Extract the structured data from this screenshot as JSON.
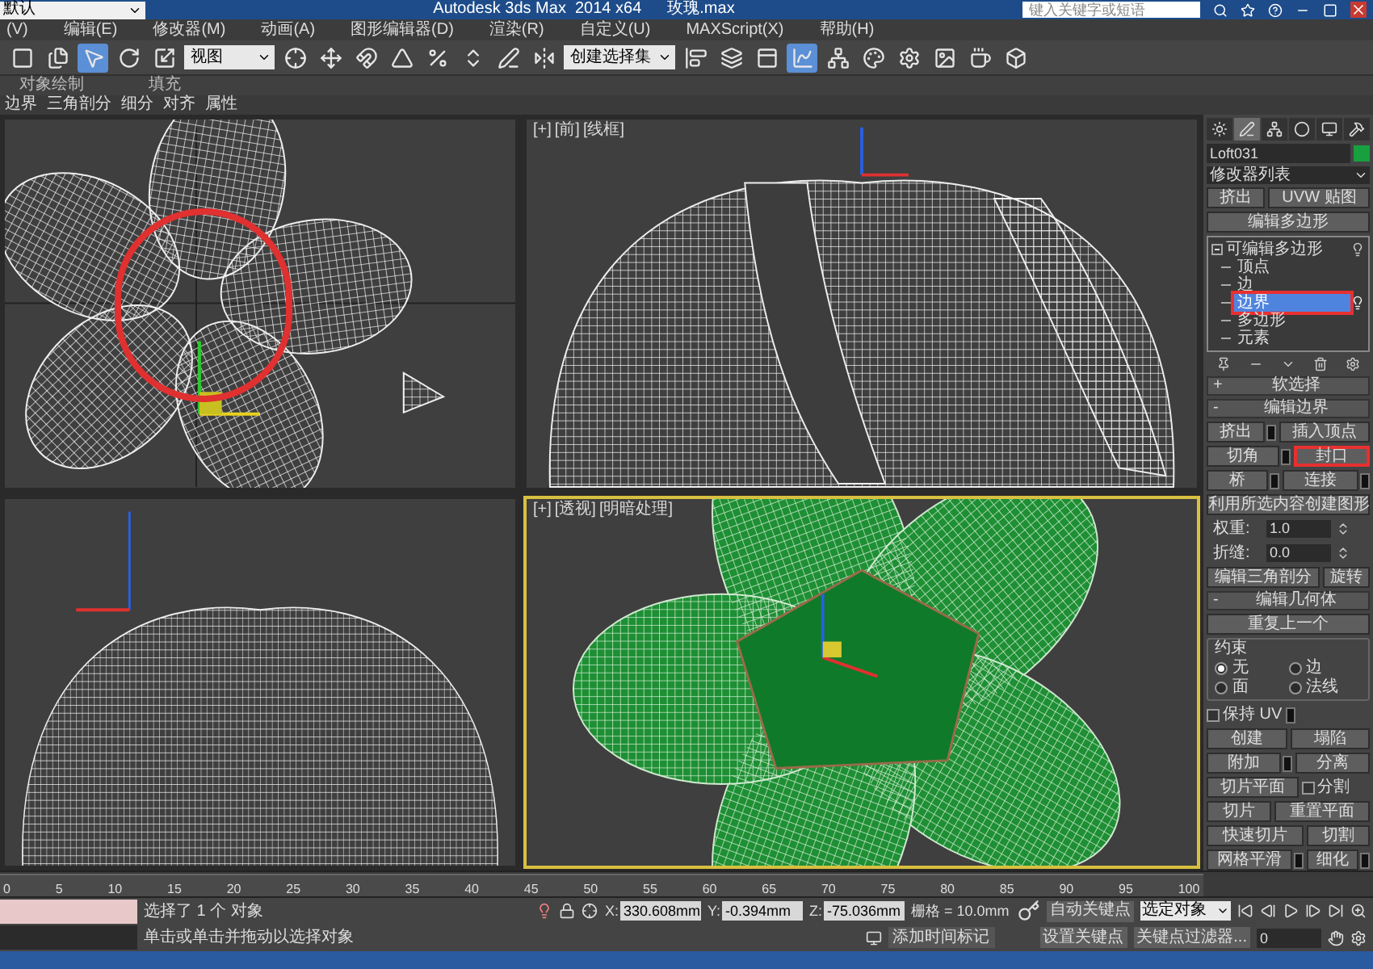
{
  "title_bar": {
    "workspace": "默认",
    "title": "Autodesk 3ds Max  2014 x64",
    "file": "玫瑰.max",
    "search_placeholder": "键入关键字或短语"
  },
  "menu": [
    "(V)",
    "编辑(E)",
    "修改器(M)",
    "动画(A)",
    "图形编辑器(D)",
    "渲染(R)",
    "自定义(U)",
    "MAXScript(X)",
    "帮助(H)"
  ],
  "toolbar": [
    {
      "kind": "tool",
      "selected": false
    },
    {
      "kind": "tool",
      "selected": false
    },
    {
      "kind": "tool",
      "selected": true
    },
    {
      "kind": "tool",
      "selected": false
    },
    {
      "kind": "tool",
      "selected": false
    },
    {
      "kind": "dropdown",
      "label": "视图"
    },
    {
      "kind": "tool",
      "selected": false
    },
    {
      "kind": "tool",
      "selected": false
    },
    {
      "kind": "tool",
      "selected": false
    },
    {
      "kind": "tool",
      "selected": false
    },
    {
      "kind": "tool",
      "selected": false
    },
    {
      "kind": "tool",
      "selected": false
    },
    {
      "kind": "tool",
      "selected": false
    },
    {
      "kind": "tool",
      "selected": false
    },
    {
      "kind": "dropdown",
      "label": "创建选择集"
    },
    {
      "kind": "tool",
      "selected": false
    },
    {
      "kind": "tool",
      "selected": false
    },
    {
      "kind": "tool",
      "selected": false
    },
    {
      "kind": "tool",
      "selected": true
    },
    {
      "kind": "tool",
      "selected": false
    },
    {
      "kind": "tool",
      "selected": false
    },
    {
      "kind": "tool",
      "selected": false
    },
    {
      "kind": "tool",
      "selected": false
    },
    {
      "kind": "tool",
      "selected": false
    },
    {
      "kind": "tool",
      "selected": false
    }
  ],
  "ribbon": {
    "groups": [
      "对象绘制",
      "填充"
    ],
    "tabs": [
      "边界",
      "三角剖分",
      "细分",
      "对齐",
      "属性"
    ]
  },
  "viewports": [
    {
      "kind": "top",
      "active": false,
      "annotated": true
    },
    {
      "kind": "front",
      "active": false,
      "labels": [
        "[+]",
        "[前]",
        "[线框]"
      ]
    },
    {
      "kind": "left",
      "active": false
    },
    {
      "kind": "perspective",
      "active": true,
      "labels": [
        "[+]",
        "[透视]",
        "[明暗处理]"
      ]
    }
  ],
  "command_panel": {
    "tabs": [
      {
        "selected": false
      },
      {
        "selected": true
      },
      {
        "selected": false
      },
      {
        "selected": false
      },
      {
        "selected": false
      },
      {
        "selected": false
      }
    ],
    "object_name": "Loft031",
    "modifier_list": "修改器列表",
    "quick_buttons": [
      "挤出",
      "UVW 贴图",
      "编辑多边形"
    ],
    "stack": [
      {
        "label": "可编辑多边形",
        "expanded": true,
        "children": [
          {
            "label": "顶点",
            "selected": false,
            "annotated": false
          },
          {
            "label": "边",
            "selected": false,
            "annotated": false
          },
          {
            "label": "边界",
            "selected": true,
            "annotated": true
          },
          {
            "label": "多边形",
            "selected": false,
            "annotated": false
          },
          {
            "label": "元素",
            "selected": false,
            "annotated": false
          }
        ]
      }
    ],
    "rollouts": [
      {
        "toggle": "+",
        "title": "软选择"
      },
      {
        "toggle": "-",
        "title": "编辑边界",
        "rows": [
          {
            "kind": "pair",
            "items": [
              {
                "kind": "button",
                "label": "挤出",
                "settings": true,
                "annotated": false
              },
              {
                "kind": "button",
                "label": "插入顶点",
                "settings": false,
                "annotated": false
              }
            ]
          },
          {
            "kind": "pair",
            "items": [
              {
                "kind": "button",
                "label": "切角",
                "settings": true,
                "annotated": false
              },
              {
                "kind": "button",
                "label": "封口",
                "settings": false,
                "annotated": true
              }
            ]
          },
          {
            "kind": "pair",
            "items": [
              {
                "kind": "button",
                "label": "桥",
                "settings": true,
                "annotated": false
              },
              {
                "kind": "button",
                "label": "连接",
                "settings": true,
                "annotated": false
              }
            ]
          },
          {
            "kind": "wide",
            "label": "利用所选内容创建图形"
          },
          {
            "kind": "spinner",
            "label": "权重:",
            "value": "1.0"
          },
          {
            "kind": "spinner",
            "label": "折缝:",
            "value": "0.0"
          },
          {
            "kind": "pair",
            "items": [
              {
                "kind": "button",
                "label": "编辑三角剖分",
                "settings": false,
                "annotated": false
              },
              {
                "kind": "button",
                "label": "旋转",
                "settings": false,
                "annotated": false
              }
            ]
          }
        ]
      },
      {
        "toggle": "-",
        "title": "编辑几何体",
        "rows": [
          {
            "kind": "wide",
            "label": "重复上一个"
          },
          {
            "kind": "radio",
            "title": "约束",
            "options": [
              {
                "label": "无",
                "selected": true
              },
              {
                "label": "边",
                "selected": false
              },
              {
                "label": "面",
                "selected": false
              },
              {
                "label": "法线",
                "selected": false
              }
            ]
          },
          {
            "kind": "pair",
            "items": [
              {
                "kind": "checkbox",
                "label": "保持 UV",
                "checked": false,
                "settings": true
              }
            ]
          },
          {
            "kind": "pair",
            "items": [
              {
                "kind": "button",
                "label": "创建",
                "settings": false,
                "annotated": false
              },
              {
                "kind": "button",
                "label": "塌陷",
                "settings": false,
                "annotated": false
              }
            ]
          },
          {
            "kind": "pair",
            "items": [
              {
                "kind": "button",
                "label": "附加",
                "settings": true,
                "annotated": false
              },
              {
                "kind": "button",
                "label": "分离",
                "settings": false,
                "annotated": false
              }
            ]
          },
          {
            "kind": "pair",
            "items": [
              {
                "kind": "button",
                "label": "切片平面",
                "settings": false,
                "annotated": false
              },
              {
                "kind": "checkbox",
                "label": "分割",
                "checked": false,
                "settings": false
              }
            ]
          },
          {
            "kind": "pair",
            "items": [
              {
                "kind": "button",
                "label": "切片",
                "settings": false,
                "annotated": false
              },
              {
                "kind": "button",
                "label": "重置平面",
                "settings": false,
                "annotated": false
              }
            ]
          },
          {
            "kind": "pair",
            "items": [
              {
                "kind": "button",
                "label": "快速切片",
                "settings": false,
                "annotated": false
              },
              {
                "kind": "button",
                "label": "切割",
                "settings": false,
                "annotated": false
              }
            ]
          },
          {
            "kind": "pair",
            "items": [
              {
                "kind": "button",
                "label": "网格平滑",
                "settings": true,
                "annotated": false
              },
              {
                "kind": "button",
                "label": "细化",
                "settings": true,
                "annotated": false
              }
            ]
          }
        ]
      }
    ]
  },
  "timeline": {
    "ticks": [
      "0",
      "5",
      "10",
      "15",
      "20",
      "25",
      "30",
      "35",
      "40",
      "45",
      "50",
      "55",
      "60",
      "65",
      "70",
      "75",
      "80",
      "85",
      "90",
      "95",
      "100"
    ]
  },
  "status": {
    "selection": "选择了 1 个 对象",
    "prompt": "单击或单击并拖动以选择对象",
    "x": "330.608mm",
    "y": "-0.394mm",
    "z": "-75.036mm",
    "x_label": "X:",
    "y_label": "Y:",
    "z_label": "Z:",
    "grid": "栅格 = 10.0mm",
    "auto_key": "自动关键点",
    "key_filter_target": "选定对象",
    "set_key": "设置关键点",
    "key_filters": "关键点过滤器...",
    "time_tag": "添加时间标记",
    "frame": "0"
  }
}
